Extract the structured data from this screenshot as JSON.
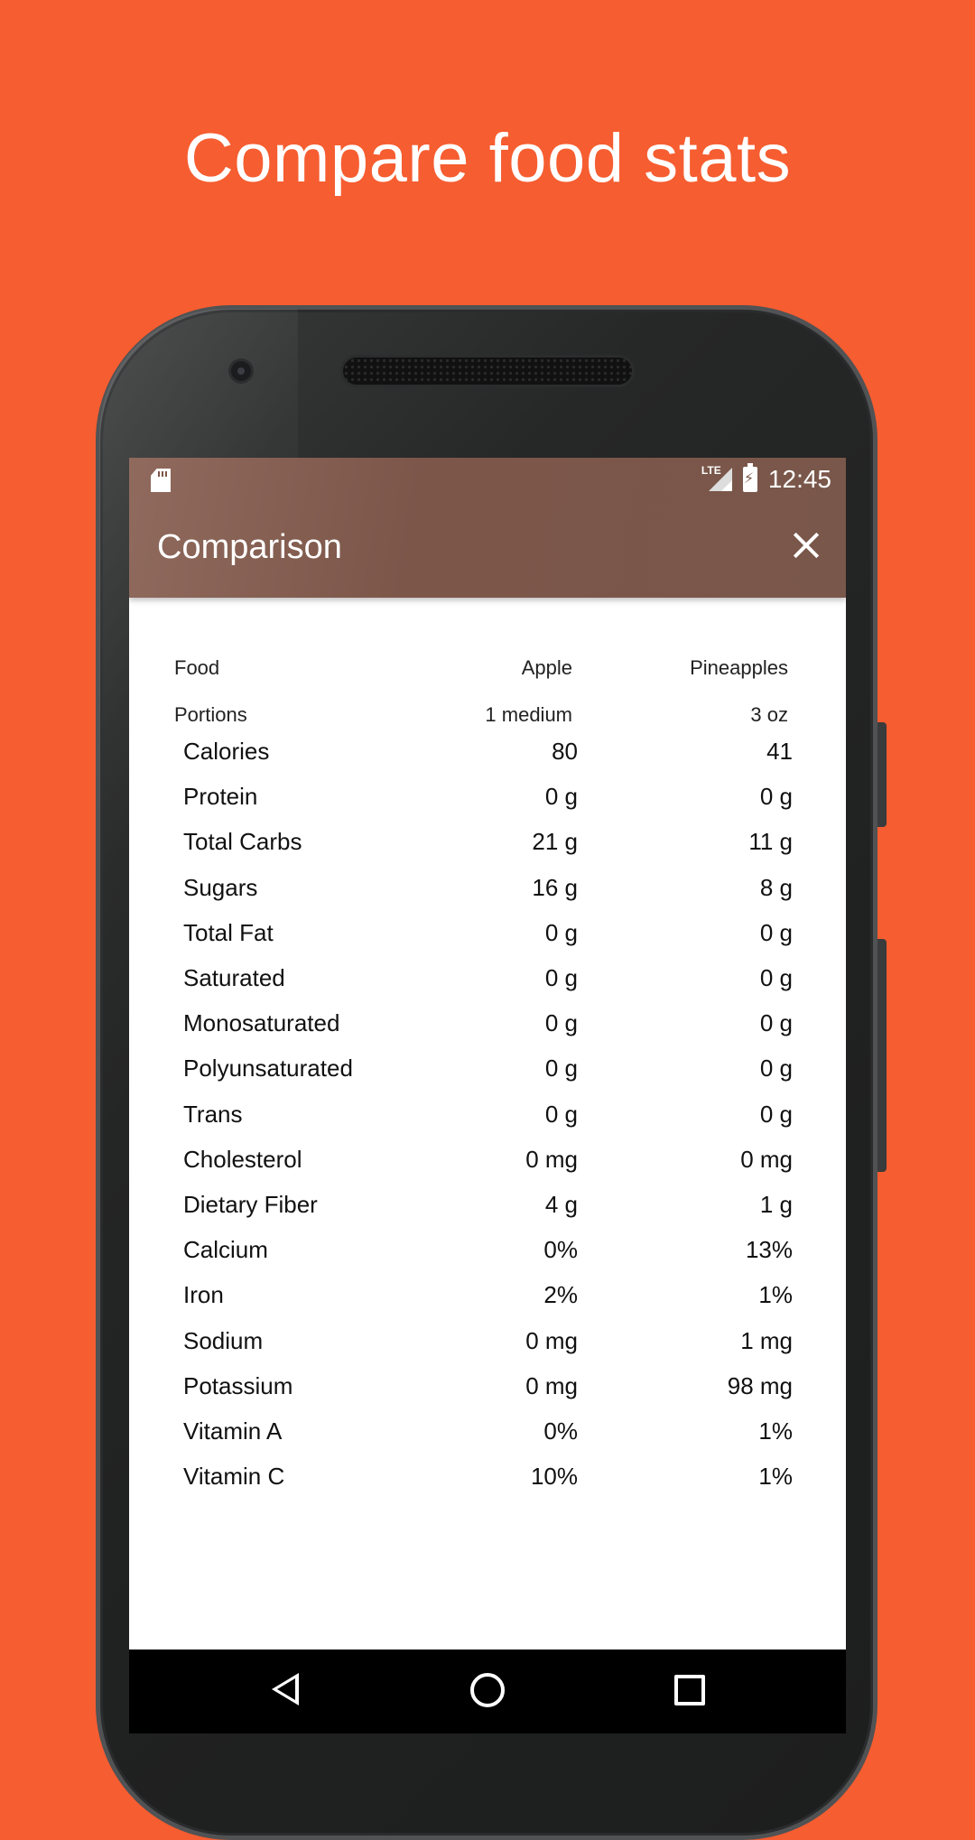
{
  "headline": "Compare food stats",
  "status_bar": {
    "time": "12:45",
    "network": "LTE"
  },
  "app_bar": {
    "title": "Comparison"
  },
  "comparison": {
    "header": {
      "label": "Food",
      "food1": "Apple",
      "food2": "Pineapples"
    },
    "portions": {
      "label": "Portions",
      "food1": "1 medium",
      "food2": "3 oz"
    },
    "rows": [
      {
        "name": "Calories",
        "food1": "80",
        "food2": "41"
      },
      {
        "name": "Protein",
        "food1": "0 g",
        "food2": "0 g"
      },
      {
        "name": "Total Carbs",
        "food1": "21 g",
        "food2": "11 g"
      },
      {
        "name": "Sugars",
        "food1": "16 g",
        "food2": "8 g"
      },
      {
        "name": "Total Fat",
        "food1": "0 g",
        "food2": "0 g"
      },
      {
        "name": "Saturated",
        "food1": "0 g",
        "food2": "0 g"
      },
      {
        "name": "Monosaturated",
        "food1": "0 g",
        "food2": "0 g"
      },
      {
        "name": "Polyunsaturated",
        "food1": "0 g",
        "food2": "0 g"
      },
      {
        "name": "Trans",
        "food1": "0 g",
        "food2": "0 g"
      },
      {
        "name": "Cholesterol",
        "food1": "0 mg",
        "food2": "0 mg"
      },
      {
        "name": "Dietary Fiber",
        "food1": "4 g",
        "food2": "1 g"
      },
      {
        "name": "Calcium",
        "food1": "0%",
        "food2": "13%"
      },
      {
        "name": "Iron",
        "food1": "2%",
        "food2": "1%"
      },
      {
        "name": "Sodium",
        "food1": "0 mg",
        "food2": "1 mg"
      },
      {
        "name": "Potassium",
        "food1": "0 mg",
        "food2": "98 mg"
      },
      {
        "name": "Vitamin A",
        "food1": "0%",
        "food2": "1%"
      },
      {
        "name": "Vitamin C",
        "food1": "10%",
        "food2": "1%"
      }
    ]
  },
  "colors": {
    "background": "#F65D30",
    "app_bar": "#7C5649",
    "phone_body": "#222323"
  },
  "icons": {
    "sd_card": "sd-card-icon",
    "signal": "lte-signal-icon",
    "battery": "battery-charging-icon",
    "close": "close-icon",
    "nav_back": "back-icon",
    "nav_home": "home-icon",
    "nav_recent": "recent-apps-icon"
  }
}
